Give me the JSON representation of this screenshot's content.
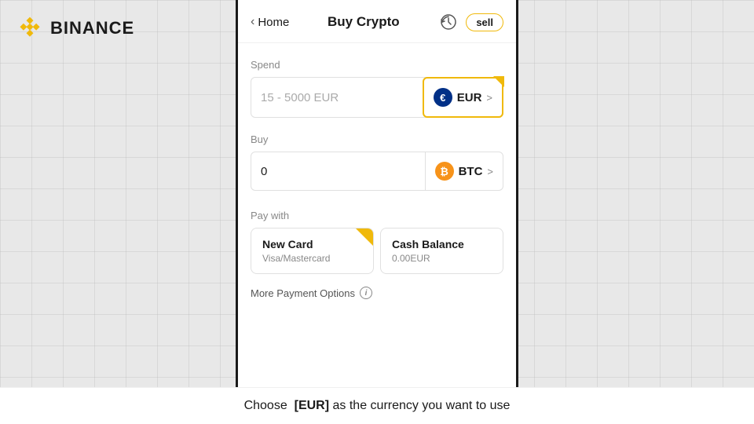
{
  "app": {
    "name": "BINANCE"
  },
  "header": {
    "back_label": "Home",
    "title": "Buy Crypto",
    "sell_label": "sell"
  },
  "spend": {
    "label": "Spend",
    "placeholder": "15 - 5000 EUR",
    "currency": "EUR",
    "currency_symbol": "€"
  },
  "buy": {
    "label": "Buy",
    "value": "0",
    "currency": "BTC",
    "currency_symbol": "₿"
  },
  "pay_with": {
    "label": "Pay with",
    "options": [
      {
        "title": "New Card",
        "subtitle": "Visa/Mastercard",
        "selected": true
      },
      {
        "title": "Cash Balance",
        "subtitle": "0.00EUR",
        "selected": false
      }
    ]
  },
  "more_payment": {
    "label": "More Payment Options"
  },
  "bottom": {
    "instruction": "Choose  [EUR] as the currency you want to use"
  }
}
